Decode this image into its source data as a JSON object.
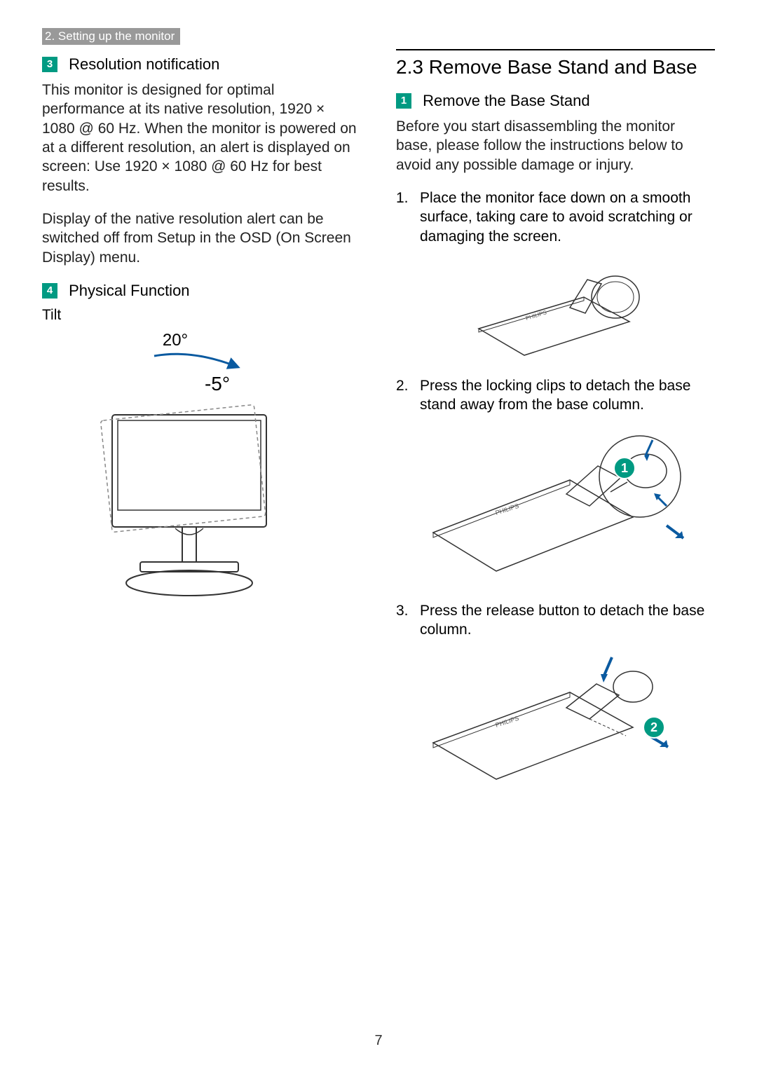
{
  "chapter_tag": "2. Setting up the monitor",
  "left": {
    "box3": "3",
    "box3_title": "Resolution notification",
    "p1": "This monitor is designed for optimal performance at its native resolution, 1920 × 1080 @ 60 Hz. When the monitor is powered on at a different resolution, an alert is displayed on screen: Use 1920 × 1080 @ 60 Hz for best results.",
    "p2": "Display of the native resolution alert can be switched off from Setup in the OSD (On Screen Display) menu.",
    "box4": "4",
    "box4_title": "Physical Function",
    "tilt_label": "Tilt",
    "tilt_up": "20°",
    "tilt_down": "-5°"
  },
  "right": {
    "section_title": "2.3  Remove Base Stand and Base",
    "box1": "1",
    "box1_title": "Remove the Base Stand",
    "intro": "Before you start disassembling the monitor base, please follow the instructions below to avoid any possible damage or injury.",
    "step1_n": "1.",
    "step1": "Place the monitor face down on a smooth surface, taking care to avoid scratching or damaging the screen.",
    "step2_n": "2.",
    "step2": "Press the locking clips to detach the base stand away from the base column.",
    "callout1": "1",
    "step3_n": "3.",
    "step3": "Press the release button to detach the base column.",
    "callout2": "2"
  },
  "page_number": "7"
}
